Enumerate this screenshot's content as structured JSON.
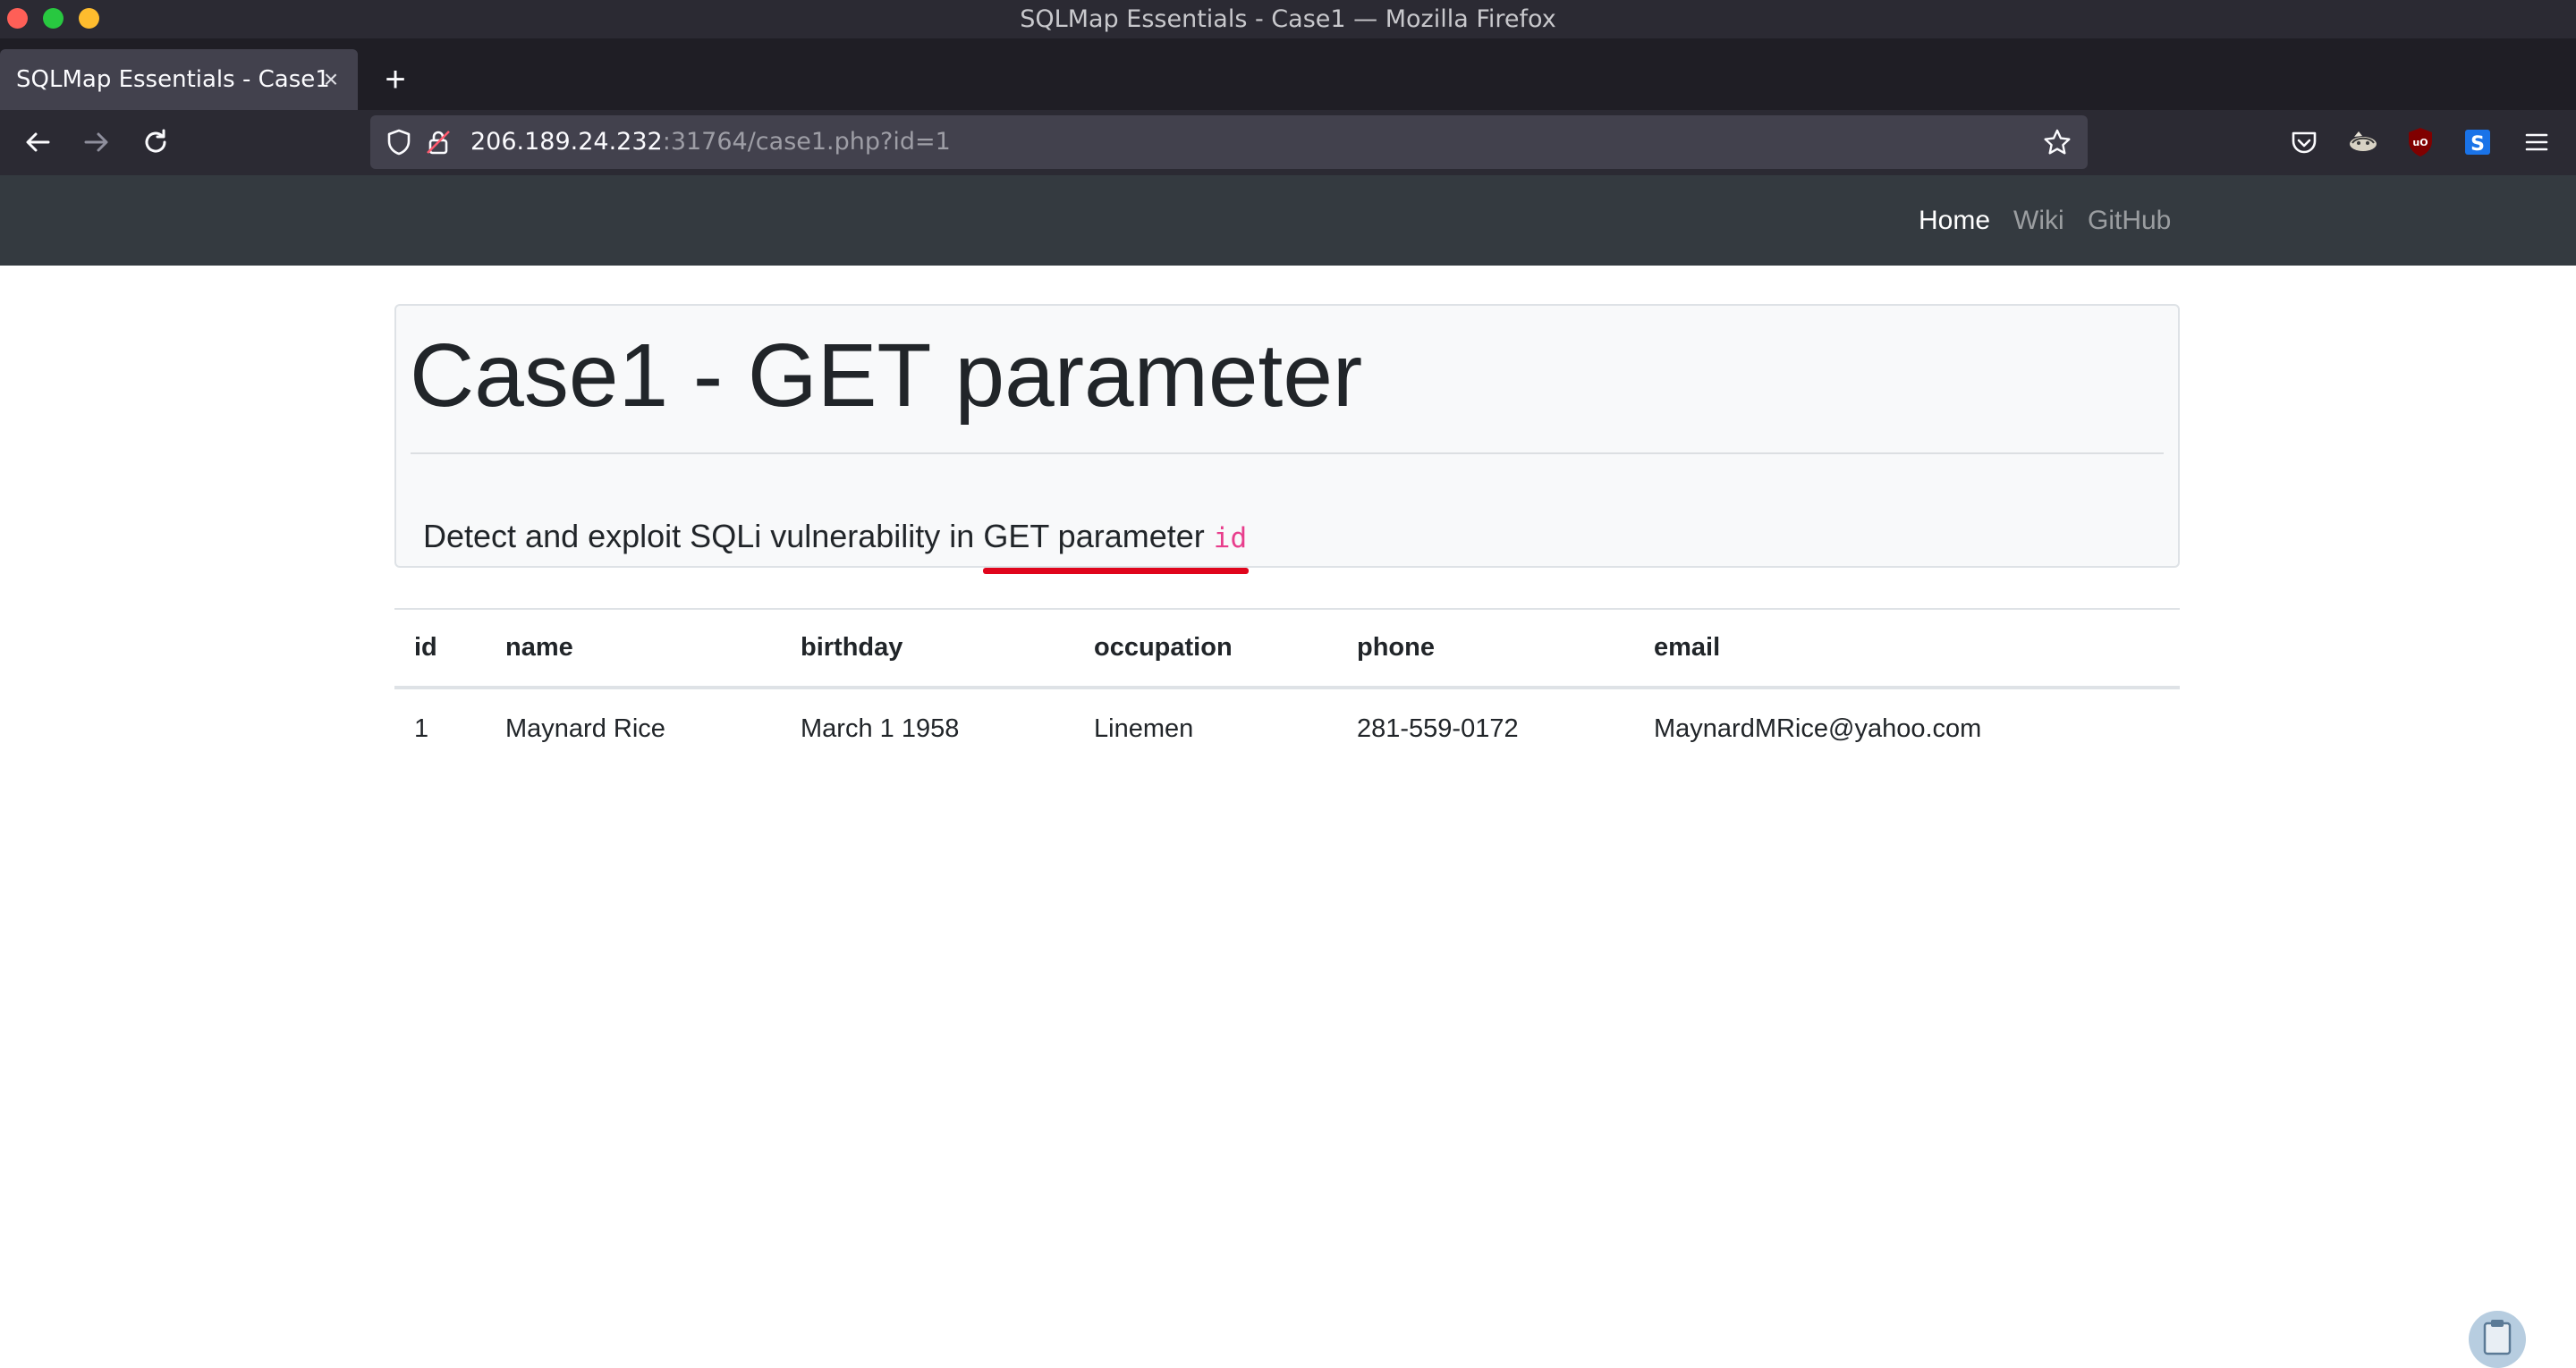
{
  "window": {
    "title": "SQLMap Essentials - Case1 — Mozilla Firefox"
  },
  "tabs": [
    {
      "label": "SQLMap Essentials - Case1",
      "active": true
    }
  ],
  "toolbar": {
    "url_host": "206.189.24.232",
    "url_path": ":31764/case1.php?id=1",
    "icons": [
      "back-icon",
      "forward-icon",
      "reload-icon",
      "shield-icon",
      "lock-icon",
      "star-icon",
      "pocket-icon",
      "extension-icon",
      "ublock-icon",
      "s-extension-icon",
      "menu-icon"
    ]
  },
  "site_nav": {
    "links": [
      {
        "label": "Home",
        "active": true
      },
      {
        "label": "Wiki",
        "active": false
      },
      {
        "label": "GitHub",
        "active": false
      }
    ]
  },
  "jumbotron": {
    "heading": "Case1 - GET parameter",
    "lead_prefix": "Detect and exploit SQLi vulnerability in ",
    "lead_highlight": "GET parameter",
    "lead_code": "id"
  },
  "table": {
    "headers": [
      "id",
      "name",
      "birthday",
      "occupation",
      "phone",
      "email"
    ],
    "rows": [
      [
        "1",
        "Maynard Rice",
        "March 1 1958",
        "Linemen",
        "281-559-0172",
        "MaynardMRice@yahoo.com"
      ]
    ]
  },
  "colors": {
    "browser_chrome": "#2b2a33",
    "site_navbar": "#343a40",
    "code_pink": "#e83e8c",
    "annotation_red": "#e0051c"
  }
}
